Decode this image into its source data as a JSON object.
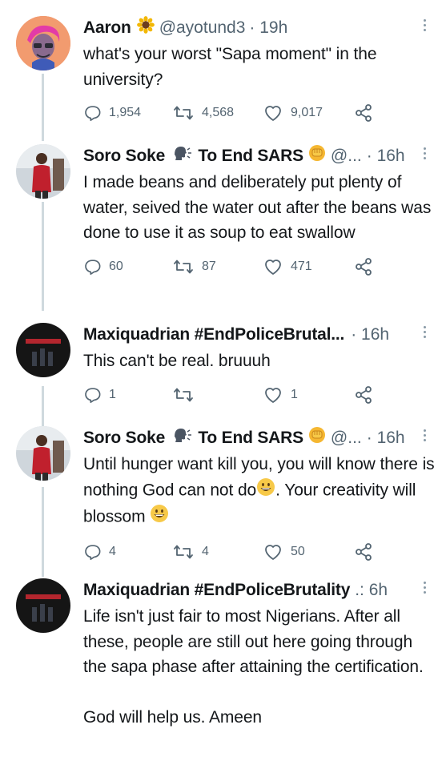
{
  "tweets": [
    {
      "name": "Aaron",
      "handle": "@ayotund3",
      "time": "· 19h",
      "text": [
        "what's your worst \"Sapa moment\" in the university?"
      ],
      "replies": "1,954",
      "retweets": "4,568",
      "likes": "9,017"
    },
    {
      "name_a": "Soro Soke",
      "name_b": "To End SARS",
      "handle": "@...",
      "time": "· 16h",
      "text": [
        "I made beans and deliberately put plenty of water, seived the water out after the beans was done to use it as soup to eat swallow"
      ],
      "replies": "60",
      "retweets": "87",
      "likes": "471"
    },
    {
      "name": "Maxiquadrian #EndPoliceBrutal...",
      "time": "· 16h",
      "text": [
        "This can't be real. bruuuh"
      ],
      "replies": "1",
      "retweets": "",
      "likes": "1"
    },
    {
      "name_a": "Soro Soke",
      "name_b": "To End SARS",
      "handle": "@...",
      "time": "· 16h",
      "text_a": "Until hunger want kill you, you will know there is nothing God can not do",
      "text_b": ". Your creativity will blossom",
      "replies": "4",
      "retweets": "4",
      "likes": "50"
    },
    {
      "name": "Maxiquadrian #EndPoliceBrutality",
      "time": ".: 6h",
      "text": [
        "Life isn't just fair to most Nigerians. After all these, people are still out here going through the sapa phase  after attaining the certification.",
        "God will help us. Ameen"
      ]
    }
  ],
  "icons": {
    "reply": "reply-icon",
    "retweet": "retweet-icon",
    "like": "heart-icon",
    "share": "share-icon",
    "more": "more-icon",
    "verified": "sunflower-emoji"
  },
  "colors": {
    "text": "#14171a",
    "muted": "#536471",
    "thread_line": "#cfd9de"
  }
}
